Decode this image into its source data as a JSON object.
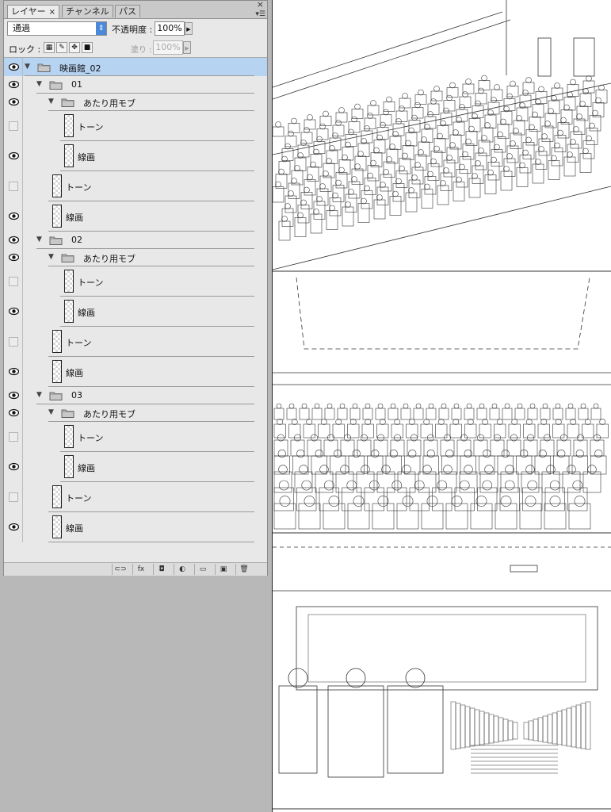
{
  "panel": {
    "tabs": [
      {
        "label": "レイヤー",
        "close": "×"
      },
      {
        "label": "チャンネル"
      },
      {
        "label": "パス"
      }
    ],
    "close_glyph": "×",
    "blend_mode": "通過",
    "opacity_label": "不透明度 :",
    "opacity_value": "100%",
    "lock_label": "ロック :",
    "fill_label": "塗り :",
    "fill_value": "100%"
  },
  "layers": [
    {
      "name": "映画館_02",
      "type": "group",
      "depth": 0,
      "visible": true,
      "expanded": true,
      "selected": true
    },
    {
      "name": "01",
      "type": "group",
      "depth": 1,
      "visible": true,
      "expanded": true
    },
    {
      "name": "あたり用モブ",
      "type": "group",
      "depth": 2,
      "visible": true,
      "expanded": true
    },
    {
      "name": "トーン",
      "type": "layer",
      "depth": 3,
      "visible": false
    },
    {
      "name": "線画",
      "type": "layer",
      "depth": 3,
      "visible": true
    },
    {
      "name": "トーン",
      "type": "layer",
      "depth": 2,
      "visible": false
    },
    {
      "name": "線画",
      "type": "layer",
      "depth": 2,
      "visible": true
    },
    {
      "name": "02",
      "type": "group",
      "depth": 1,
      "visible": true,
      "expanded": true
    },
    {
      "name": "あたり用モブ",
      "type": "group",
      "depth": 2,
      "visible": true,
      "expanded": true
    },
    {
      "name": "トーン",
      "type": "layer",
      "depth": 3,
      "visible": false
    },
    {
      "name": "線画",
      "type": "layer",
      "depth": 3,
      "visible": true
    },
    {
      "name": "トーン",
      "type": "layer",
      "depth": 2,
      "visible": false
    },
    {
      "name": "線画",
      "type": "layer",
      "depth": 2,
      "visible": true
    },
    {
      "name": "03",
      "type": "group",
      "depth": 1,
      "visible": true,
      "expanded": true
    },
    {
      "name": "あたり用モブ",
      "type": "group",
      "depth": 2,
      "visible": true,
      "expanded": true
    },
    {
      "name": "トーン",
      "type": "layer",
      "depth": 3,
      "visible": false
    },
    {
      "name": "線画",
      "type": "layer",
      "depth": 3,
      "visible": true
    },
    {
      "name": "トーン",
      "type": "layer",
      "depth": 2,
      "visible": false
    },
    {
      "name": "線画",
      "type": "layer",
      "depth": 2,
      "visible": true
    }
  ],
  "bottom_bar": {
    "buttons": [
      {
        "icon": "link-icon",
        "glyph": "⊂⊃"
      },
      {
        "icon": "fx-icon",
        "glyph": "fx"
      },
      {
        "icon": "mask-icon",
        "glyph": "◘"
      },
      {
        "icon": "adjustment-icon",
        "glyph": "◐"
      },
      {
        "icon": "new-group-icon",
        "glyph": "▭"
      },
      {
        "icon": "new-layer-icon",
        "glyph": "▣"
      },
      {
        "icon": "trash-icon",
        "glyph": "🗑"
      }
    ]
  },
  "canvas": {
    "content": "line-art manga panels of cinema auditorium"
  }
}
